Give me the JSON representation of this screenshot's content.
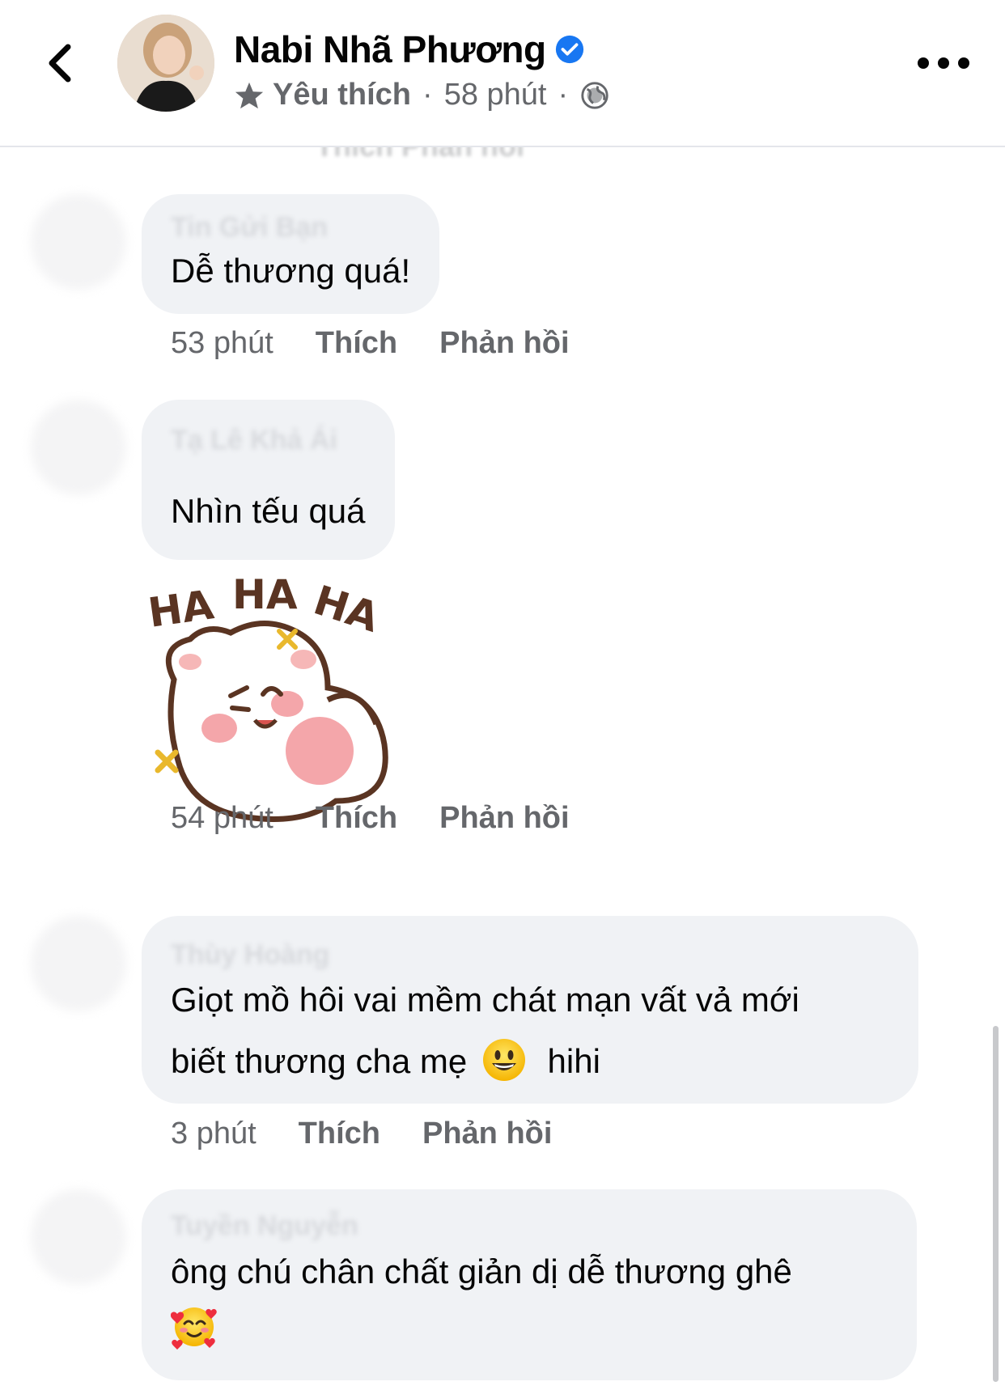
{
  "header": {
    "page_name": "Nabi Nhã Phương",
    "favorite_label": "Yêu thích",
    "separator": "·",
    "post_time": "58 phút"
  },
  "ghost_actions_text": "Thích   Phản hồi",
  "comments": [
    {
      "author": "Tin Gửi Bạn",
      "text": "Dễ thương quá!",
      "time": "53 phút",
      "like_label": "Thích",
      "reply_label": "Phản hồi"
    },
    {
      "author_line1": "Tạ Lê Khả Ái",
      "text": "Nhìn tếu quá",
      "sticker": "HA HA HA",
      "time": "54 phút",
      "like_label": "Thích",
      "reply_label": "Phản hồi"
    },
    {
      "author": "Thùy Hoàng",
      "text_line1": "Giọt mồ hôi vai mềm chát mạn vất vả mới",
      "text_line2_a": "biết thương cha mẹ",
      "text_line2_b": "hihi",
      "emoji": "smiling-face-icon",
      "time": "3 phút",
      "like_label": "Thích",
      "reply_label": "Phản hồi"
    },
    {
      "author": "Tuyền Nguyễn",
      "text": "ông chú chân chất giản dị dễ thương ghê",
      "emoji": "smiling-face-with-hearts-icon"
    }
  ],
  "colors": {
    "bubble": "#f0f2f5",
    "secondary_text": "#65676b",
    "verified": "#1877f2"
  }
}
